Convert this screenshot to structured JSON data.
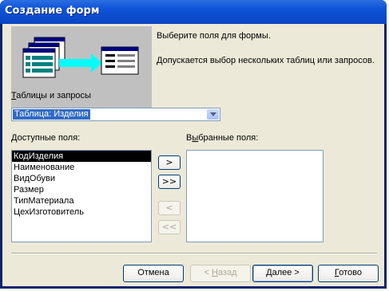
{
  "window": {
    "title": "Создание форм"
  },
  "intro": {
    "line1": "Выберите поля для формы.",
    "line2": "Допускается выбор нескольких таблиц или запросов."
  },
  "tables": {
    "label_u": "Т",
    "label_rest": "аблицы и запросы",
    "selected": "Таблица: Изделия"
  },
  "available": {
    "label_u": "Д",
    "label_rest": "оступные поля:",
    "items": [
      "КодИзделия",
      "Наименование",
      "ВидОбуви",
      "Размер",
      "ТипМатериала",
      "ЦехИзготовитель"
    ],
    "selected_index": 0
  },
  "selected_fields": {
    "label_pre": "В",
    "label_u": "ы",
    "label_rest": "бранные поля:",
    "items": []
  },
  "move_buttons": {
    "add_one": ">",
    "add_all": ">>",
    "remove_one": "<",
    "remove_all": "<<"
  },
  "footer": {
    "cancel": "Отмена",
    "back_pre": "< ",
    "back_u": "Н",
    "back_rest": "азад",
    "next_u": "Д",
    "next_rest": "алее >",
    "finish_u": "Г",
    "finish_rest": "отово"
  }
}
